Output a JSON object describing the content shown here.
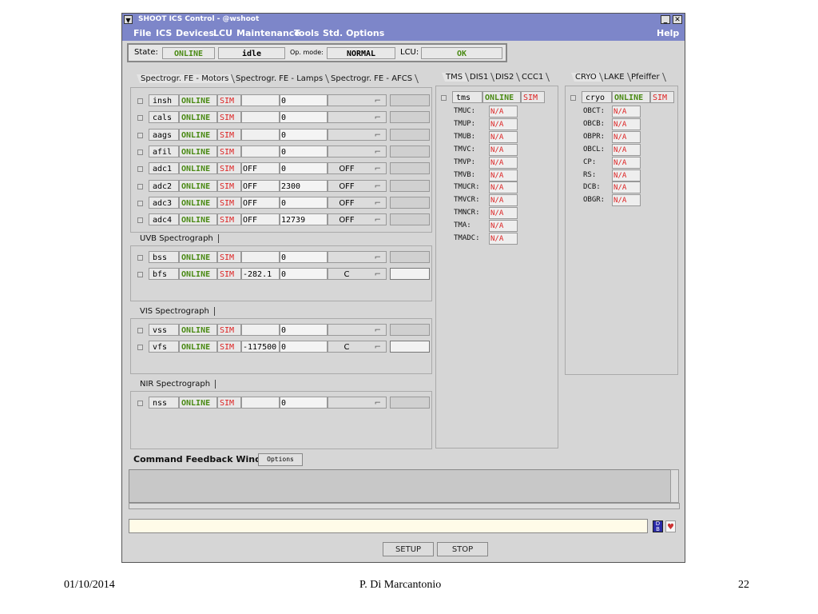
{
  "window": {
    "title": "SHOOT ICS Control - @wshoot",
    "minimize_glyph": "_",
    "close_glyph": "✕",
    "menu_glyph": "▼"
  },
  "menu": [
    "File",
    "ICS",
    "Devices",
    "LCU",
    "Maintenance",
    "Tools",
    "Std. Options",
    "Help"
  ],
  "state_bar": {
    "state_label": "State:",
    "state_value": "ONLINE",
    "substate_value": "idle",
    "opmode_label": "Op. mode:",
    "opmode_value": "NORMAL",
    "lcu_label": "LCU:",
    "lcu_value": "OK"
  },
  "left_panel": {
    "tabs": [
      "Spectrogr. FE - Motors",
      "Spectrogr. FE - Lamps",
      "Spectrogr. FE - AFCS"
    ],
    "devices": [
      {
        "name": "insh",
        "status": "ONLINE",
        "mode": "SIM",
        "v1": "",
        "v2": "0",
        "dd": "",
        "last_white": false
      },
      {
        "name": "cals",
        "status": "ONLINE",
        "mode": "SIM",
        "v1": "",
        "v2": "0",
        "dd": "",
        "last_white": false
      },
      {
        "name": "aags",
        "status": "ONLINE",
        "mode": "SIM",
        "v1": "",
        "v2": "0",
        "dd": "",
        "last_white": false
      },
      {
        "name": "afil",
        "status": "ONLINE",
        "mode": "SIM",
        "v1": "",
        "v2": "0",
        "dd": "",
        "last_white": false
      },
      {
        "name": "adc1",
        "status": "ONLINE",
        "mode": "SIM",
        "v1": "OFF",
        "v2": "0",
        "dd": "OFF",
        "last_white": false
      },
      {
        "name": "adc2",
        "status": "ONLINE",
        "mode": "SIM",
        "v1": "OFF",
        "v2": "2300",
        "dd": "OFF",
        "last_white": false
      },
      {
        "name": "adc3",
        "status": "ONLINE",
        "mode": "SIM",
        "v1": "OFF",
        "v2": "0",
        "dd": "OFF",
        "last_white": false
      },
      {
        "name": "adc4",
        "status": "ONLINE",
        "mode": "SIM",
        "v1": "OFF",
        "v2": "12739",
        "dd": "OFF",
        "last_white": false
      }
    ]
  },
  "uvb": {
    "title": "UVB Spectrograph",
    "devices": [
      {
        "name": "bss",
        "status": "ONLINE",
        "mode": "SIM",
        "v1": "",
        "v2": "0",
        "dd": "",
        "last_white": false
      },
      {
        "name": "bfs",
        "status": "ONLINE",
        "mode": "SIM",
        "v1": "-282.1",
        "v2": "0",
        "dd": "C",
        "last_white": true
      }
    ]
  },
  "vis": {
    "title": "VIS Spectrograph",
    "devices": [
      {
        "name": "vss",
        "status": "ONLINE",
        "mode": "SIM",
        "v1": "",
        "v2": "0",
        "dd": "",
        "last_white": false
      },
      {
        "name": "vfs",
        "status": "ONLINE",
        "mode": "SIM",
        "v1": "-117500",
        "v2": "0",
        "dd": "C",
        "last_white": true
      }
    ]
  },
  "nir": {
    "title": "NIR Spectrograph",
    "devices": [
      {
        "name": "nss",
        "status": "ONLINE",
        "mode": "SIM",
        "v1": "",
        "v2": "0",
        "dd": "",
        "last_white": false
      }
    ]
  },
  "dropdown_arrow": "⌐",
  "tms_panel": {
    "tabs": [
      "TMS",
      "DIS1",
      "DIS2",
      "CCC1"
    ],
    "device": {
      "name": "tms",
      "status": "ONLINE",
      "mode": "SIM"
    },
    "values": [
      {
        "k": "TMUC:",
        "v": "N/A"
      },
      {
        "k": "TMUP:",
        "v": "N/A"
      },
      {
        "k": "TMUB:",
        "v": "N/A"
      },
      {
        "k": "TMVC:",
        "v": "N/A"
      },
      {
        "k": "TMVP:",
        "v": "N/A"
      },
      {
        "k": "TMVB:",
        "v": "N/A"
      },
      {
        "k": "TMUCR:",
        "v": "N/A"
      },
      {
        "k": "TMVCR:",
        "v": "N/A"
      },
      {
        "k": "TMNCR:",
        "v": "N/A"
      },
      {
        "k": "TMA:",
        "v": "N/A"
      },
      {
        "k": "TMADC:",
        "v": "N/A"
      }
    ]
  },
  "cryo_panel": {
    "tabs": [
      "CRYO",
      "LAKE",
      "Pfeiffer"
    ],
    "device": {
      "name": "cryo",
      "status": "ONLINE",
      "mode": "SIM"
    },
    "values": [
      {
        "k": "OBCT:",
        "v": "N/A"
      },
      {
        "k": "OBCB:",
        "v": "N/A"
      },
      {
        "k": "OBPR:",
        "v": "N/A"
      },
      {
        "k": "OBCL:",
        "v": "N/A"
      },
      {
        "k": "CP:",
        "v": "N/A"
      },
      {
        "k": "RS:",
        "v": "N/A"
      },
      {
        "k": "DCB:",
        "v": "N/A"
      },
      {
        "k": "OBGR:",
        "v": "N/A"
      }
    ]
  },
  "feedback": {
    "title": "Command Feedback Window",
    "options_label": "Options",
    "cmd_icon_text": "D B",
    "heart_glyph": "♥"
  },
  "buttons": {
    "setup": "SETUP",
    "stop": "STOP"
  },
  "footer": {
    "date": "01/10/2014",
    "author": "P. Di Marcantonio",
    "page": "22"
  },
  "colors": {
    "online": "#4a8a14",
    "sim": "#dd2222",
    "titlebar": "#7d86c9"
  }
}
